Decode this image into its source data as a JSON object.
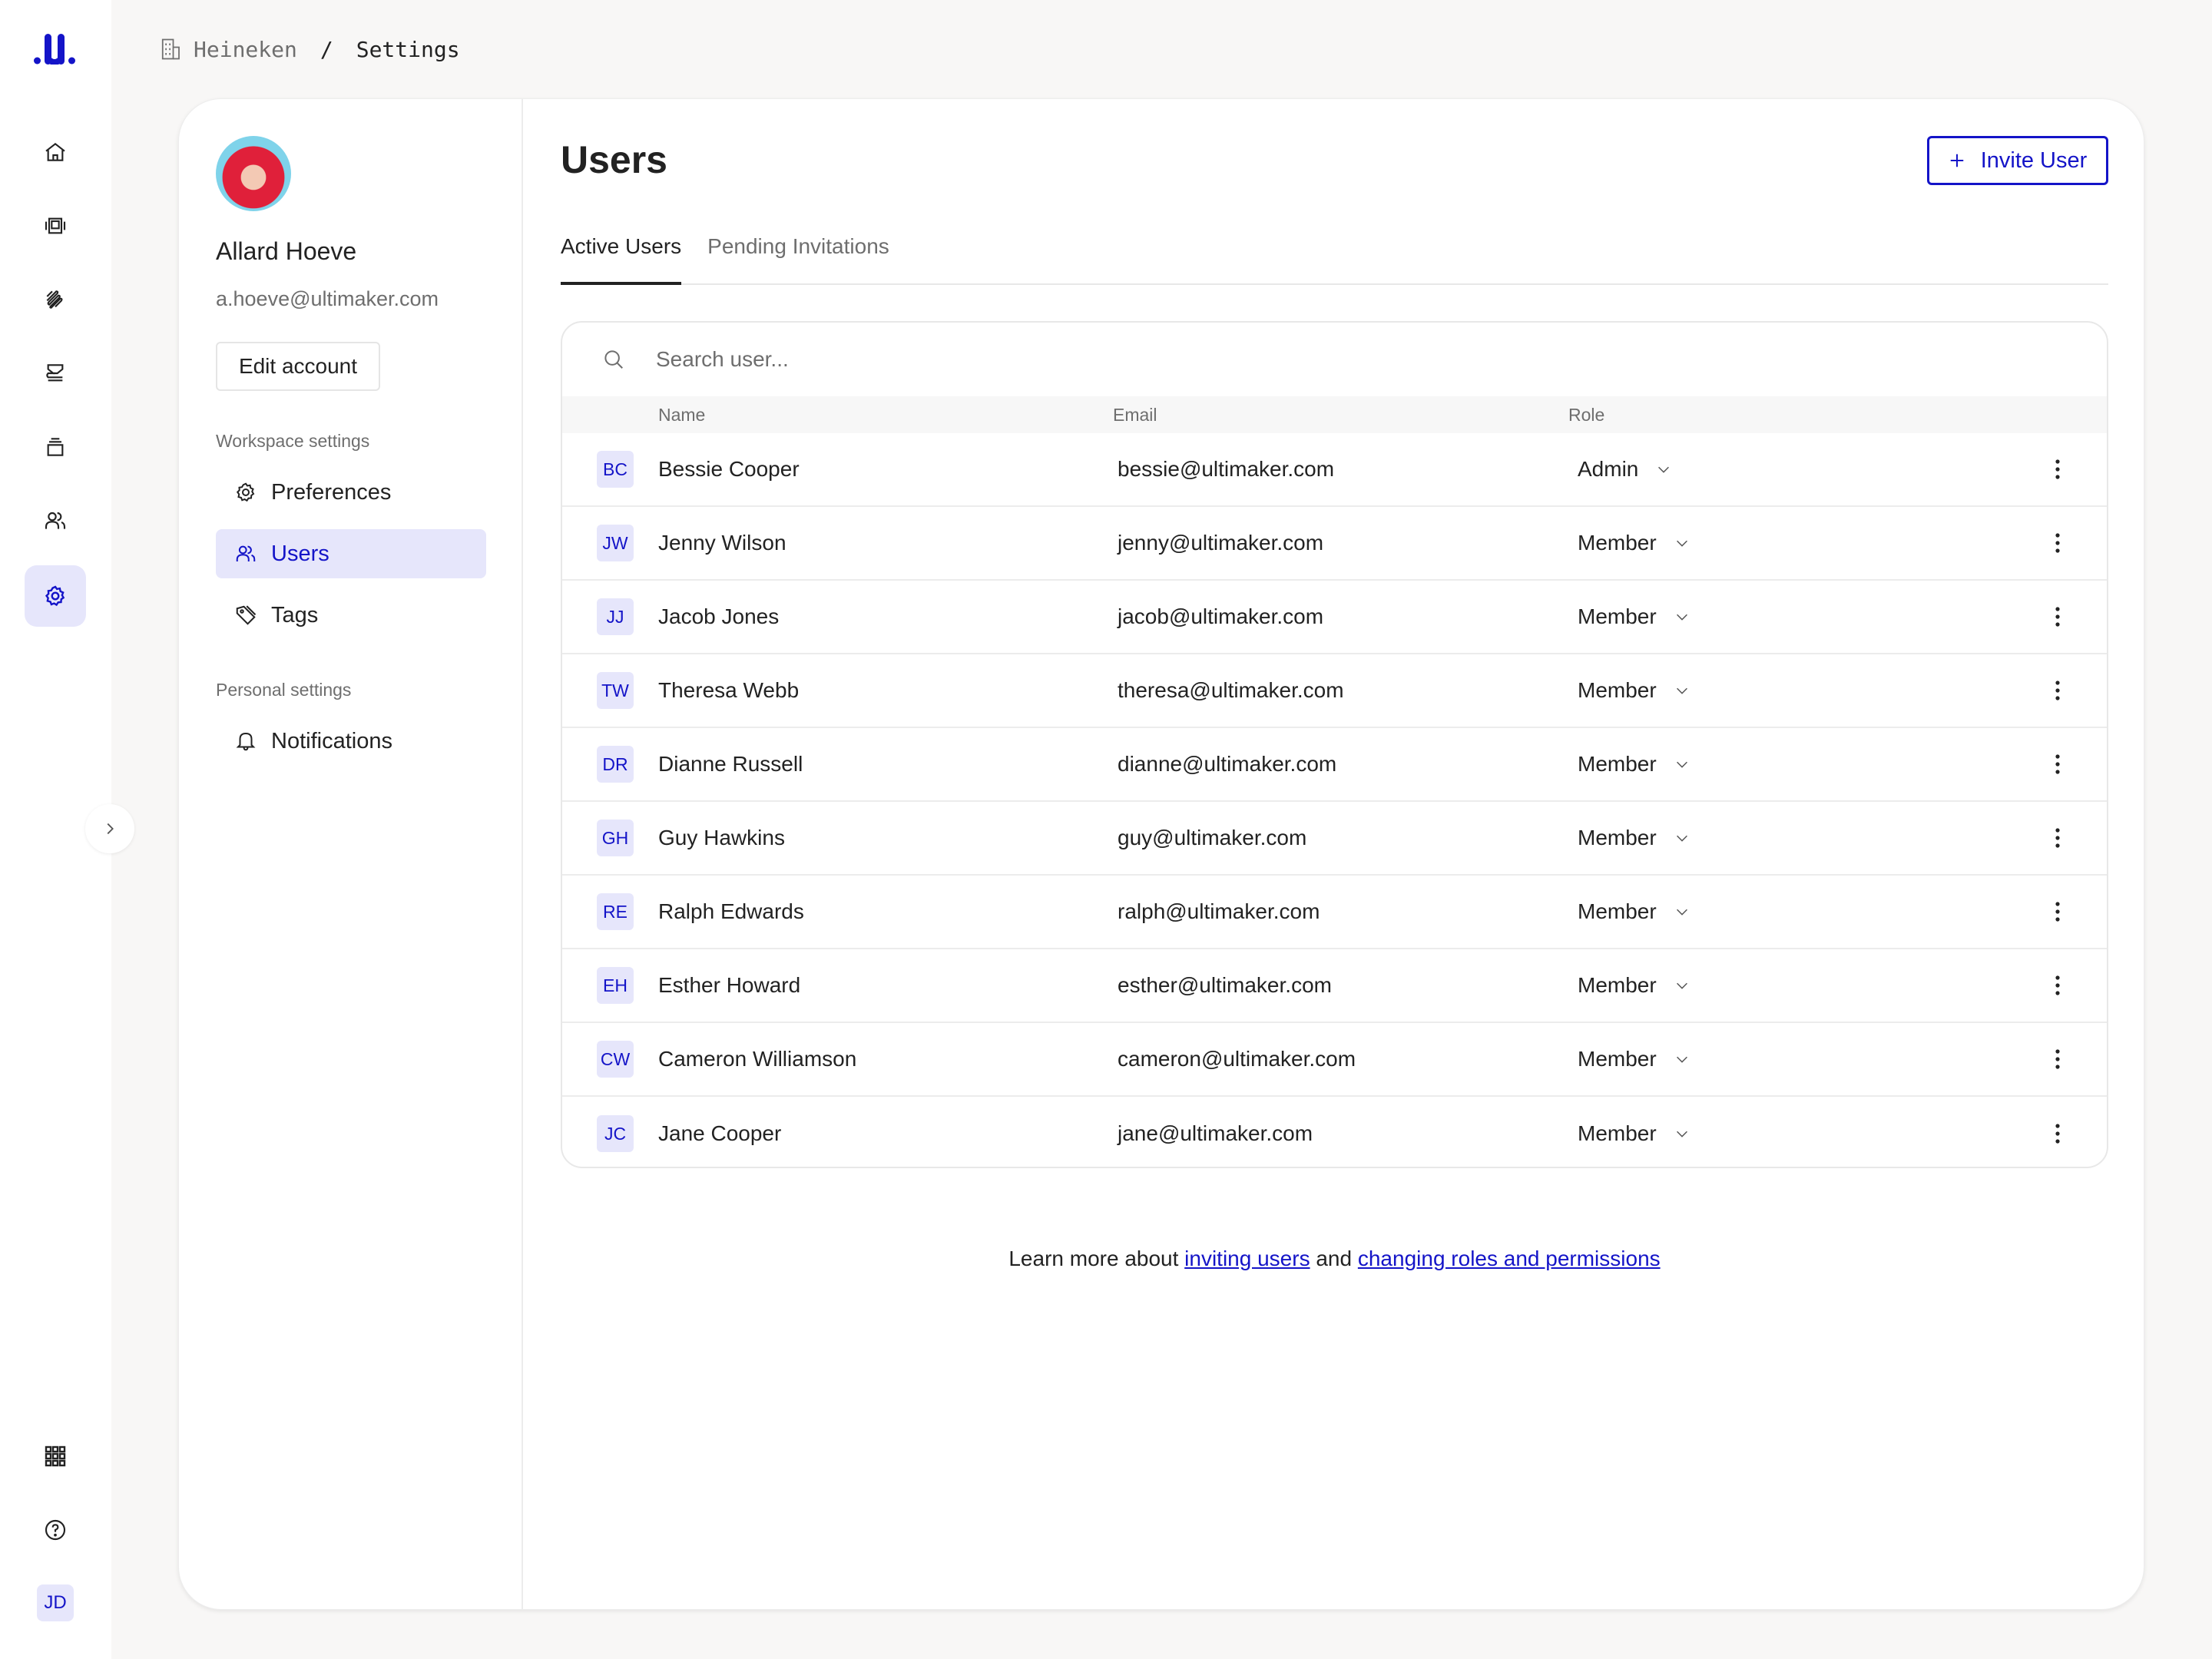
{
  "breadcrumb": {
    "organization": "Heineken",
    "separator": "/",
    "current": "Settings"
  },
  "rail": {
    "items": [
      {
        "name": "home-icon"
      },
      {
        "name": "printers-icon"
      },
      {
        "name": "materials-icon"
      },
      {
        "name": "print-jobs-icon"
      },
      {
        "name": "library-icon"
      },
      {
        "name": "team-icon"
      },
      {
        "name": "settings-icon",
        "active": true
      }
    ],
    "bottom": [
      {
        "name": "apps-grid-icon"
      },
      {
        "name": "help-icon"
      }
    ],
    "user_initials": "JD"
  },
  "profile": {
    "name": "Allard Hoeve",
    "email": "a.hoeve@ultimaker.com",
    "edit_label": "Edit account"
  },
  "settings_nav": {
    "workspace_heading": "Workspace settings",
    "workspace_items": [
      {
        "label": "Preferences",
        "icon": "gear-icon"
      },
      {
        "label": "Users",
        "icon": "users-icon",
        "active": true
      },
      {
        "label": "Tags",
        "icon": "tag-icon"
      }
    ],
    "personal_heading": "Personal settings",
    "personal_items": [
      {
        "label": "Notifications",
        "icon": "bell-icon"
      }
    ]
  },
  "main": {
    "title": "Users",
    "invite_label": "Invite User",
    "tabs": [
      {
        "label": "Active Users",
        "active": true
      },
      {
        "label": "Pending Invitations"
      }
    ],
    "search_placeholder": "Search user...",
    "columns": {
      "name": "Name",
      "email": "Email",
      "role": "Role"
    },
    "users": [
      {
        "initials": "BC",
        "name": "Bessie Cooper",
        "email": "bessie@ultimaker.com",
        "role": "Admin"
      },
      {
        "initials": "JW",
        "name": "Jenny Wilson",
        "email": "jenny@ultimaker.com",
        "role": "Member"
      },
      {
        "initials": "JJ",
        "name": "Jacob Jones",
        "email": "jacob@ultimaker.com",
        "role": "Member"
      },
      {
        "initials": "TW",
        "name": "Theresa Webb",
        "email": "theresa@ultimaker.com",
        "role": "Member"
      },
      {
        "initials": "DR",
        "name": "Dianne Russell",
        "email": "dianne@ultimaker.com",
        "role": "Member"
      },
      {
        "initials": "GH",
        "name": "Guy Hawkins",
        "email": "guy@ultimaker.com",
        "role": "Member"
      },
      {
        "initials": "RE",
        "name": "Ralph Edwards",
        "email": "ralph@ultimaker.com",
        "role": "Member"
      },
      {
        "initials": "EH",
        "name": "Esther Howard",
        "email": "esther@ultimaker.com",
        "role": "Member"
      },
      {
        "initials": "CW",
        "name": "Cameron Williamson",
        "email": "cameron@ultimaker.com",
        "role": "Member"
      },
      {
        "initials": "JC",
        "name": "Jane Cooper",
        "email": "jane@ultimaker.com",
        "role": "Member"
      }
    ],
    "footer": {
      "prefix": "Learn more about ",
      "link1": "inviting users",
      "middle": " and ",
      "link2": "changing roles and permissions"
    }
  },
  "colors": {
    "accent": "#1414c8",
    "accent_bg": "#e6e6fb",
    "page_bg": "#f8f7f6"
  }
}
